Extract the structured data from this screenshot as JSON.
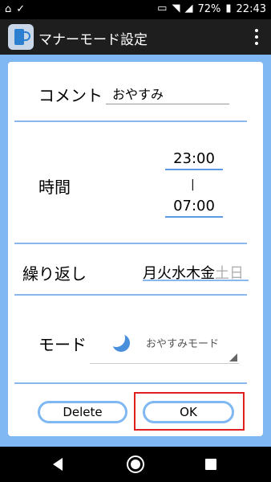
{
  "status_bar": {
    "battery": "72%",
    "time": "22:43",
    "icons": [
      "app-notification-icon",
      "tapcard-icon",
      "cast-icon",
      "wifi-icon",
      "no-sim-icon",
      "battery-icon"
    ]
  },
  "app_bar": {
    "title": "マナーモード設定",
    "icon": "manner-mode-app-icon",
    "menu_icon": "overflow-menu-icon"
  },
  "form": {
    "comment_label": "コメント",
    "comment_value": "おやすみ",
    "time_label": "時間",
    "start_time": "23:00",
    "separator": "|",
    "end_time": "07:00",
    "repeat_label": "繰り返し",
    "days_on": "月火水木金",
    "days_off": "土日",
    "mode_label": "モード",
    "mode_value": "おやすみモード",
    "mode_icon": "moon-icon"
  },
  "buttons": {
    "delete": "Delete",
    "ok": "OK"
  },
  "colors": {
    "background": "#7fb8f2",
    "accent": "#5c9ae6",
    "highlight": "#e0201e"
  }
}
